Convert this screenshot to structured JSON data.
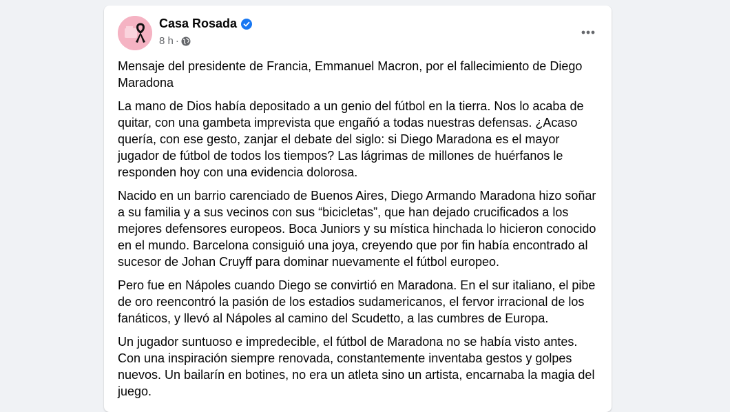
{
  "post": {
    "author": "Casa Rosada",
    "time": "8 h",
    "separator": "·",
    "icons": {
      "verified": "verified-badge-icon",
      "audience": "globe-icon",
      "more": "more-options-icon",
      "avatar_ribbon": "mourning-ribbon-icon"
    },
    "colors": {
      "verified_blue": "#1877f2",
      "avatar_bg": "#f5b3c3"
    },
    "paragraphs": [
      "Mensaje del presidente de Francia, Emmanuel Macron, por el fallecimiento de Diego Maradona",
      "La mano de Dios había depositado a un genio del fútbol en la tierra. Nos lo acaba de quitar, con una gambeta imprevista que engañó a todas nuestras defensas. ¿Acaso quería, con ese gesto, zanjar el debate del siglo: si Diego Maradona es el mayor jugador de fútbol de todos los tiempos? Las lágrimas de millones de huérfanos le responden hoy con una evidencia dolorosa.",
      "Nacido en un barrio carenciado de Buenos Aires, Diego Armando Maradona hizo soñar a su familia y a sus vecinos con sus “bicicletas”, que han dejado crucificados a los mejores defensores europeos. Boca Juniors y su mística hinchada lo hicieron conocido en el mundo. Barcelona consiguió una joya, creyendo que por fin había encontrado al sucesor de Johan Cruyff para dominar nuevamente el fútbol europeo.",
      "Pero fue en Nápoles cuando Diego se convirtió en Maradona. En el sur italiano, el pibe de oro reencontró la pasión de los estadios sudamericanos, el fervor irracional de los fanáticos, y llevó al Nápoles al camino del Scudetto, a las cumbres de Europa.",
      "Un jugador suntuoso e impredecible, el fútbol de Maradona no se había visto antes. Con una inspiración siempre renovada, constantemente inventaba gestos y golpes nuevos. Un bailarín en botines, no era un atleta sino un artista, encarnaba la magia del juego."
    ]
  }
}
